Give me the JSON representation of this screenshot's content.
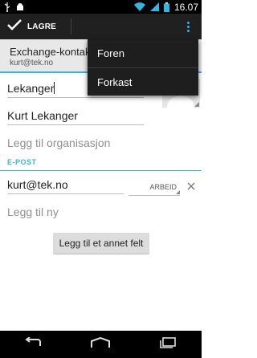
{
  "status_bar": {
    "time": "16.07",
    "icons": [
      "usb-icon",
      "android-debug-icon",
      "wifi-icon",
      "signal-icon",
      "battery-icon"
    ]
  },
  "action_bar": {
    "done_label": "LAGRE",
    "done_icon": "checkmark-icon",
    "overflow_icon": "overflow-menu-icon"
  },
  "account": {
    "type": "Exchange-kontakt",
    "email": "kurt@tek.no"
  },
  "name_fields": {
    "family_name_value": "Lekanger",
    "display_name_value": "Kurt Lekanger",
    "organization_placeholder": "Legg til organisasjon"
  },
  "email_section": {
    "label": "E-POST",
    "email_value": "kurt@tek.no",
    "type_value": "ARBEID",
    "add_new_placeholder": "Legg til ny"
  },
  "add_field_button": "Legg til et annet felt",
  "overflow_menu": {
    "items": [
      {
        "label": "Foren"
      },
      {
        "label": "Forkast"
      }
    ]
  },
  "nav_bar": {
    "icons": [
      "back-icon",
      "home-icon",
      "recent-apps-icon"
    ]
  },
  "colors": {
    "accent": "#33b5e5",
    "action_bar_bg": "#202020",
    "menu_bg": "#1e1e1e",
    "header_bg": "#e8e8e8"
  }
}
